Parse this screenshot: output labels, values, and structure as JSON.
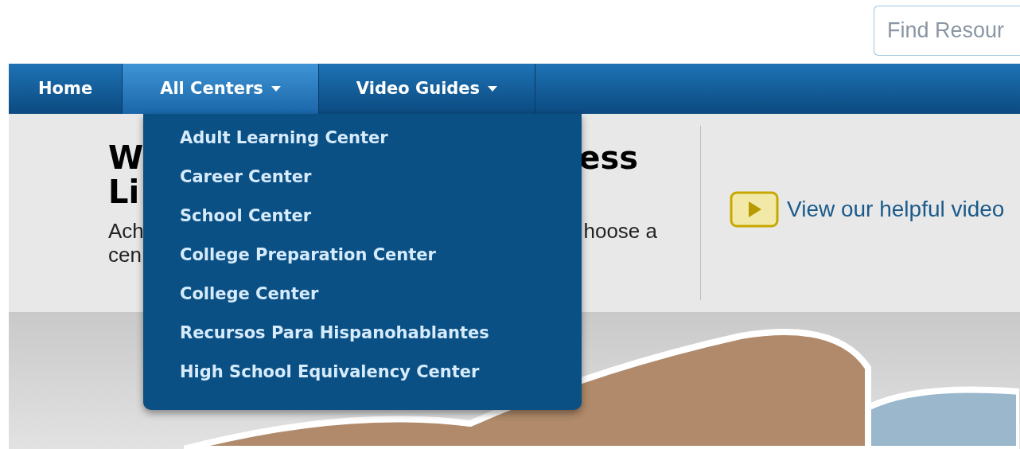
{
  "search": {
    "placeholder": "Find Resour"
  },
  "nav": [
    {
      "label": "Home",
      "selected": false,
      "dropdown": false
    },
    {
      "label": "All Centers",
      "selected": true,
      "dropdown": true
    },
    {
      "label": "Video Guides",
      "selected": false,
      "dropdown": true
    }
  ],
  "dropdown_menu": [
    "Adult Learning Center",
    "Career Center",
    "School Center",
    "College Preparation Center",
    "College Center",
    "Recursos Para Hispanohablantes",
    "High School Equivalency Center"
  ],
  "hero": {
    "heading_lines": [
      {
        "left": "W",
        "right": "ess"
      },
      {
        "left": "Li"
      }
    ],
    "text_lines": [
      {
        "left": "Ach",
        "right": "hoose a"
      },
      {
        "left": "cen"
      }
    ],
    "video_link": "View our helpful video"
  }
}
